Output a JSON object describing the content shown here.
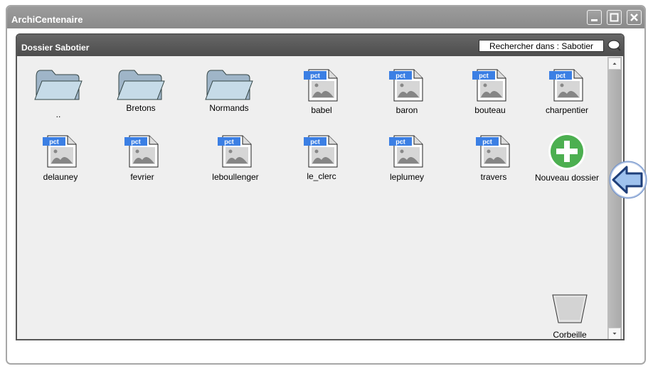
{
  "window": {
    "title": "ArchiCentenaire"
  },
  "window_buttons": [
    "minimize-icon",
    "maximize-icon",
    "close-icon"
  ],
  "panel": {
    "title": "Dossier Sabotier",
    "search_text": "Rechercher dans : Sabotier"
  },
  "items": {
    "parent": {
      "label": "..",
      "kind": "folder"
    },
    "bretons": {
      "label": "Bretons",
      "kind": "folder"
    },
    "normands": {
      "label": "Normands",
      "kind": "folder"
    },
    "babel": {
      "label": "babel",
      "kind": "pct"
    },
    "baron": {
      "label": "baron",
      "kind": "pct"
    },
    "bouteau": {
      "label": "bouteau",
      "kind": "pct"
    },
    "charpentier": {
      "label": "charpentier",
      "kind": "pct"
    },
    "delauney": {
      "label": "delauney",
      "kind": "pct"
    },
    "fevrier": {
      "label": "fevrier",
      "kind": "pct"
    },
    "leboullenger": {
      "label": "leboullenger",
      "kind": "pct"
    },
    "le_clerc": {
      "label": "le_clerc",
      "kind": "pct"
    },
    "leplumey": {
      "label": "leplumey",
      "kind": "pct"
    },
    "travers": {
      "label": "travers",
      "kind": "pct"
    }
  },
  "file_badge": "pct",
  "new_folder": {
    "label": "Nouveau dossier"
  },
  "trash": {
    "label": "Corbeille"
  },
  "colors": {
    "accent_green": "#4caf50",
    "badge_blue": "#3b7fe4",
    "back_button": "#b7c9e8"
  }
}
